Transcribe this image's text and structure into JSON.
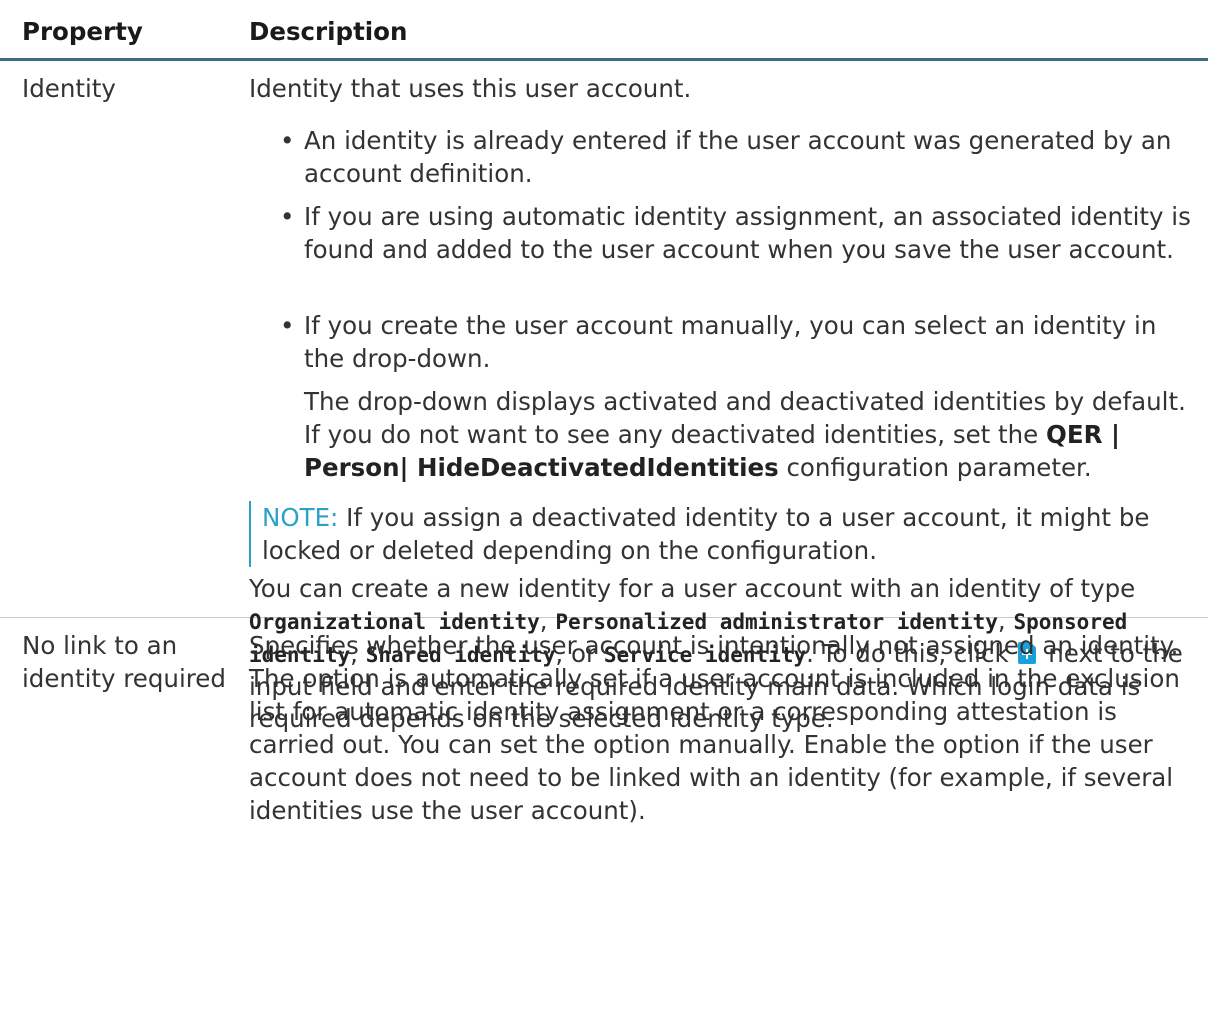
{
  "header": {
    "property": "Property",
    "description": "Description"
  },
  "rows": [
    {
      "property": "Identity",
      "intro": "Identity that uses this user account.",
      "bullets": [
        "An identity is already entered if the user account was generated by an account definition.",
        "If you are using automatic identity assignment, an associated identity is found and added to the user account when you save the user account.",
        "If you create the user account manually, you can select an identity in the drop-down."
      ],
      "bullet3_extra": {
        "before": "The drop-down displays activated and deactivated identities by default. If you do not want to see any deactivated identities, set the ",
        "param": "QER | Person| HideDeactivatedIdentities",
        "after": " configuration parameter."
      },
      "note": {
        "label": "NOTE:",
        "text": " If you assign a deactivated identity to a user account, it might be locked or deleted depending on the configuration."
      },
      "create": {
        "t1": "You can create a new identity for a user account with an identity of type ",
        "type1": "Organizational identity",
        "sep1": ", ",
        "type2": "Personalized administrator identity",
        "sep2": ", ",
        "type3": "Sponsored identity",
        "sep3": ", ",
        "type4": "Shared identity",
        "sep4": ", or ",
        "type5": "Service identity",
        "t2": ". To do this, click ",
        "icon": "add-new-icon",
        "t3": " next to the input field and enter the required identity main data. Which login data is required depends on the selected identity type."
      }
    },
    {
      "property": "No link to an identity required",
      "description": "Specifies whether the user account is intentionally not assigned an identity. The option is automatically set if a user account is included in the exclusion list for automatic identity assignment or a corresponding attestation is carried out. You can set the option manually. Enable the option if the user account does not need to be linked with an identity (for example, if several identities use the user account)."
    }
  ]
}
